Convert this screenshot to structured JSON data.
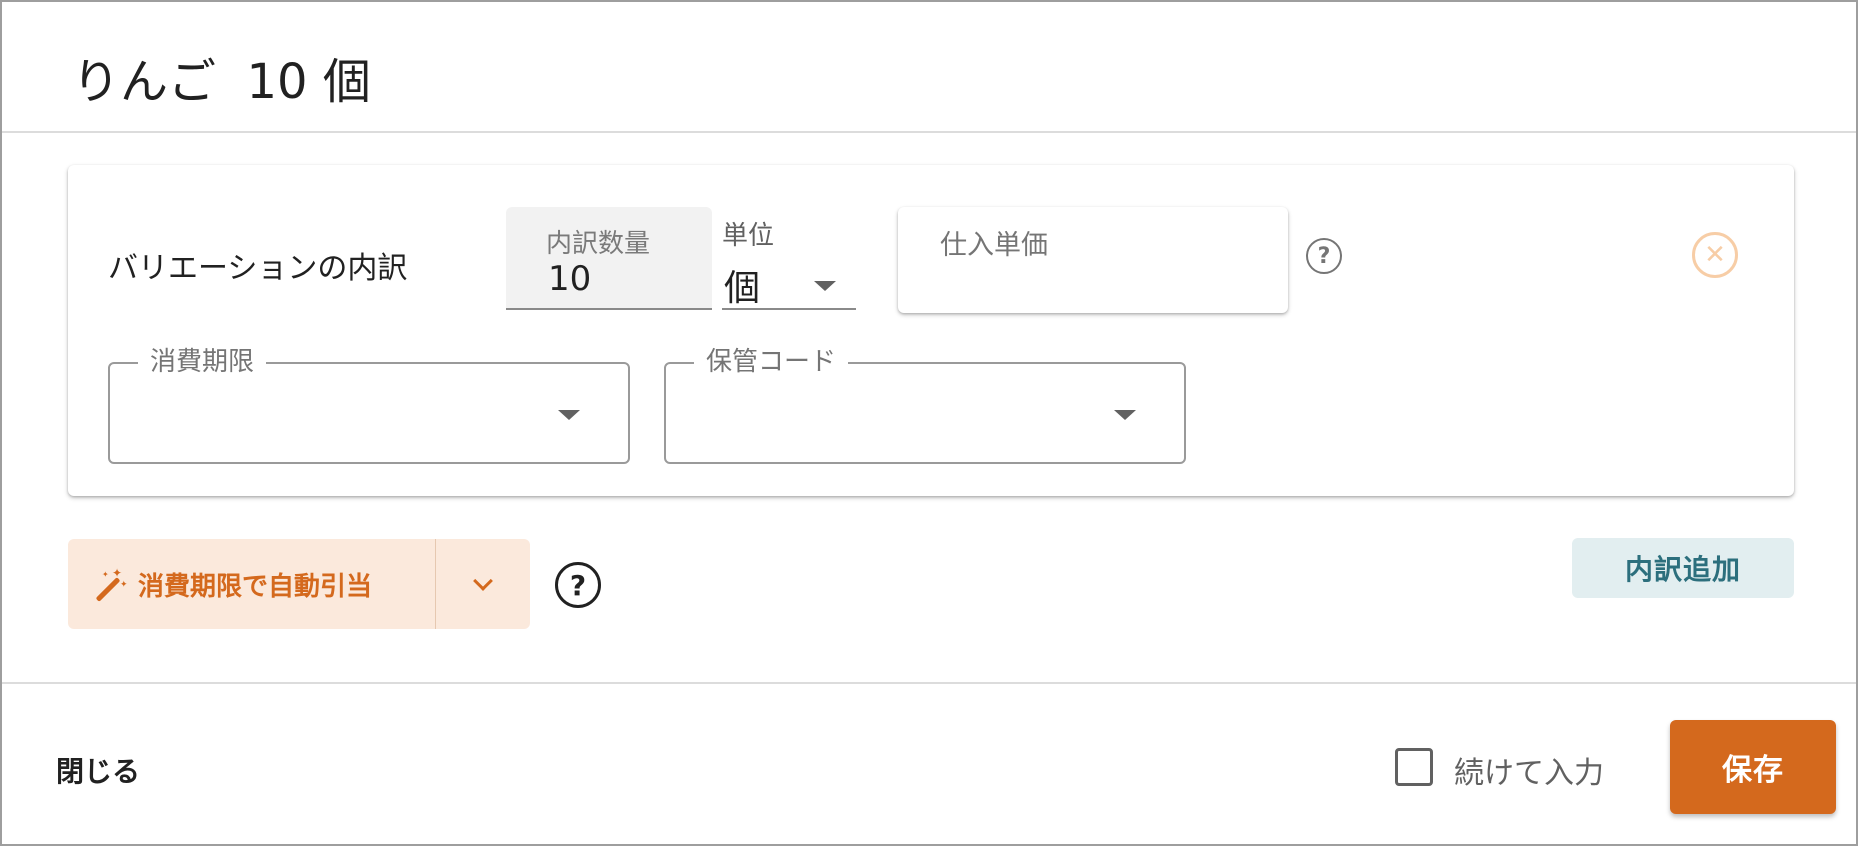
{
  "dialog": {
    "title": "りんご  10 個",
    "close_label": "閉じる",
    "continue_label": "続けて入力",
    "save_label": "保存"
  },
  "breakdown": {
    "row_label": "バリエーションの内訳",
    "quantity_label": "内訳数量",
    "quantity_value": "10",
    "unit_label": "単位",
    "unit_value": "個",
    "unit_price_label": "仕入単価",
    "expiry_label": "消費期限",
    "storage_code_label": "保管コード"
  },
  "actions": {
    "auto_assign_label": "消費期限で自動引当",
    "add_breakdown_label": "内訳追加"
  },
  "icons": {
    "help": "?",
    "remove": "✕",
    "wand": "auto-fix-wand-icon"
  },
  "colors": {
    "accent": "#d4691d",
    "accent_light": "#fbe9dc",
    "teal_text": "#2c6f7d",
    "teal_bg": "#e2eef0"
  }
}
